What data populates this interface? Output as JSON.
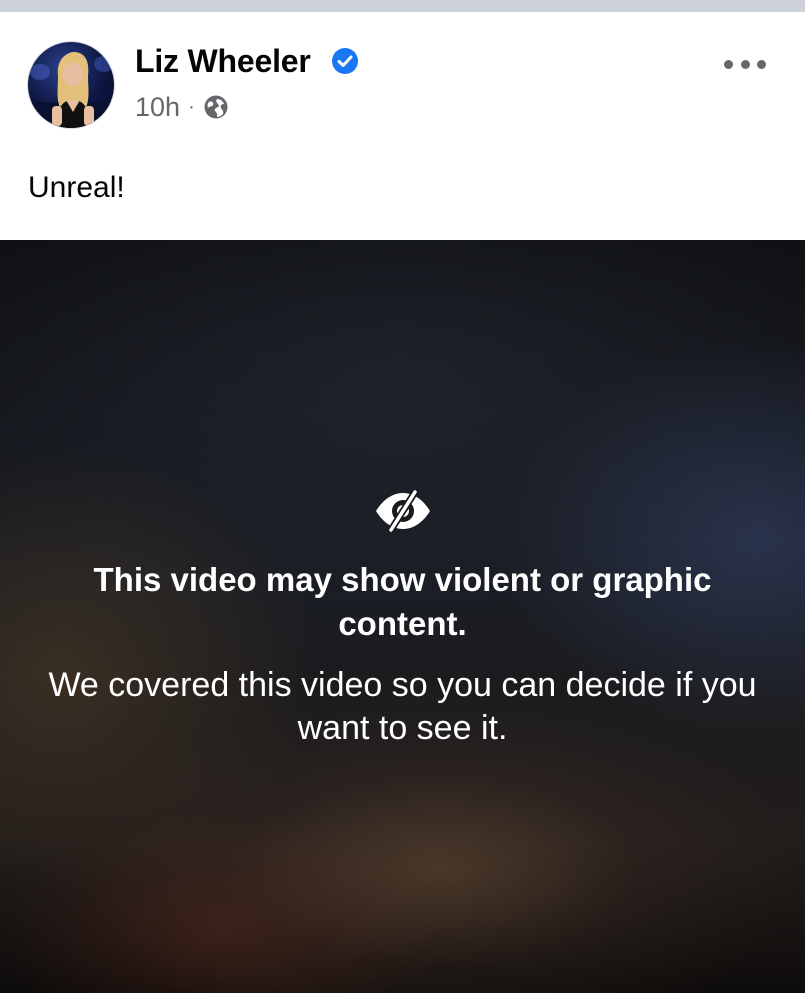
{
  "post": {
    "author": "Liz Wheeler",
    "verified": true,
    "time": "10h",
    "separator": "·",
    "audience_icon": "globe-icon",
    "more_icon": "more-options-icon",
    "text": "Unreal!"
  },
  "video_overlay": {
    "icon": "eye-slash-icon",
    "title": "This video may show violent or graphic content.",
    "body": "We covered this video so you can decide if you want to see it."
  },
  "colors": {
    "verified_blue": "#1877f2",
    "secondary_text": "#65676b",
    "primary_text": "#050505"
  }
}
